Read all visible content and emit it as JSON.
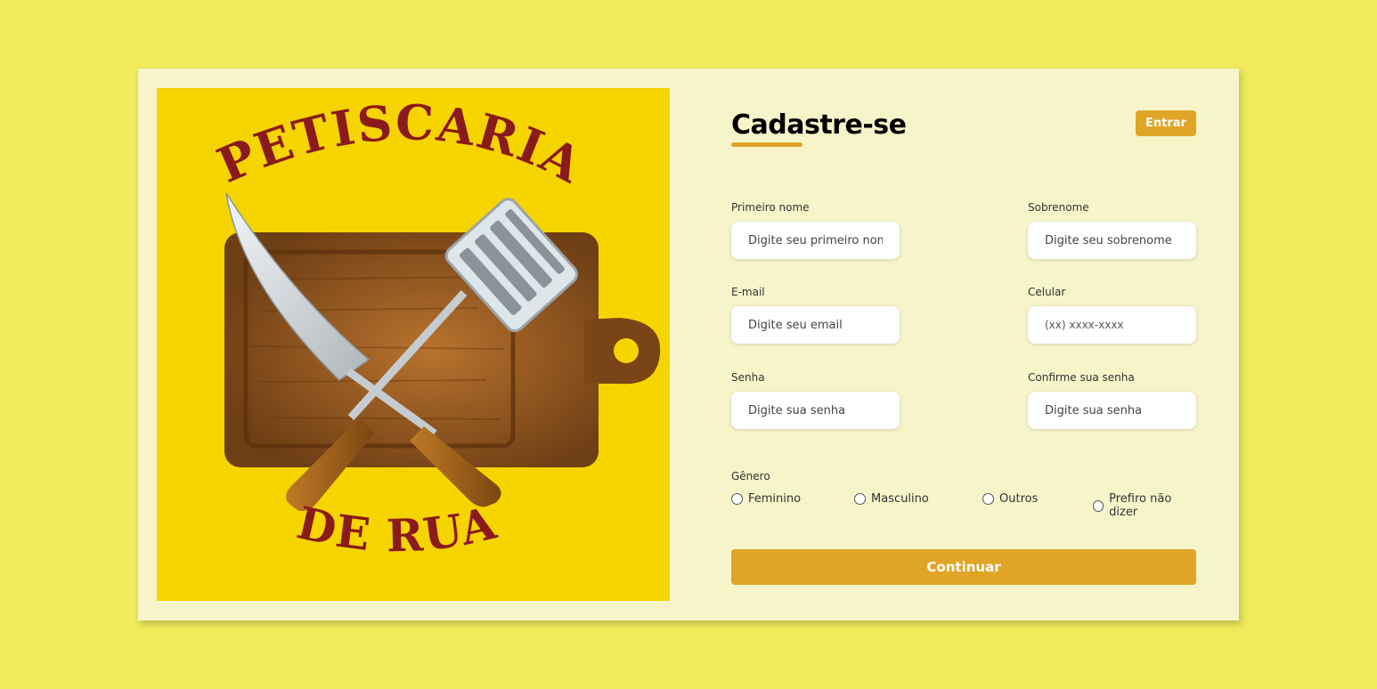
{
  "logo": {
    "line1": "PETISCARIA",
    "line2": "DE RUA"
  },
  "header": {
    "title": "Cadastre-se",
    "login_label": "Entrar"
  },
  "form": {
    "first_name": {
      "label": "Primeiro nome",
      "placeholder": "Digite seu primeiro nome"
    },
    "last_name": {
      "label": "Sobrenome",
      "placeholder": "Digite seu sobrenome"
    },
    "email": {
      "label": "E-mail",
      "placeholder": "Digite seu email"
    },
    "phone": {
      "label": "Celular",
      "placeholder": "(xx) xxxx-xxxx"
    },
    "password": {
      "label": "Senha",
      "placeholder": "Digite sua senha"
    },
    "confirm_password": {
      "label": "Confirme sua senha",
      "placeholder": "Digite sua senha"
    }
  },
  "gender": {
    "label": "Gênero",
    "options": [
      "Feminino",
      "Masculino",
      "Outros",
      "Prefiro não dizer"
    ]
  },
  "continue_label": "Continuar",
  "colors": {
    "page_background": "#f0ec5c",
    "card_background": "#f7f4ca",
    "accent": "#e0a526",
    "logo_background": "#f5d400",
    "logo_text": "#8b1a1a"
  }
}
